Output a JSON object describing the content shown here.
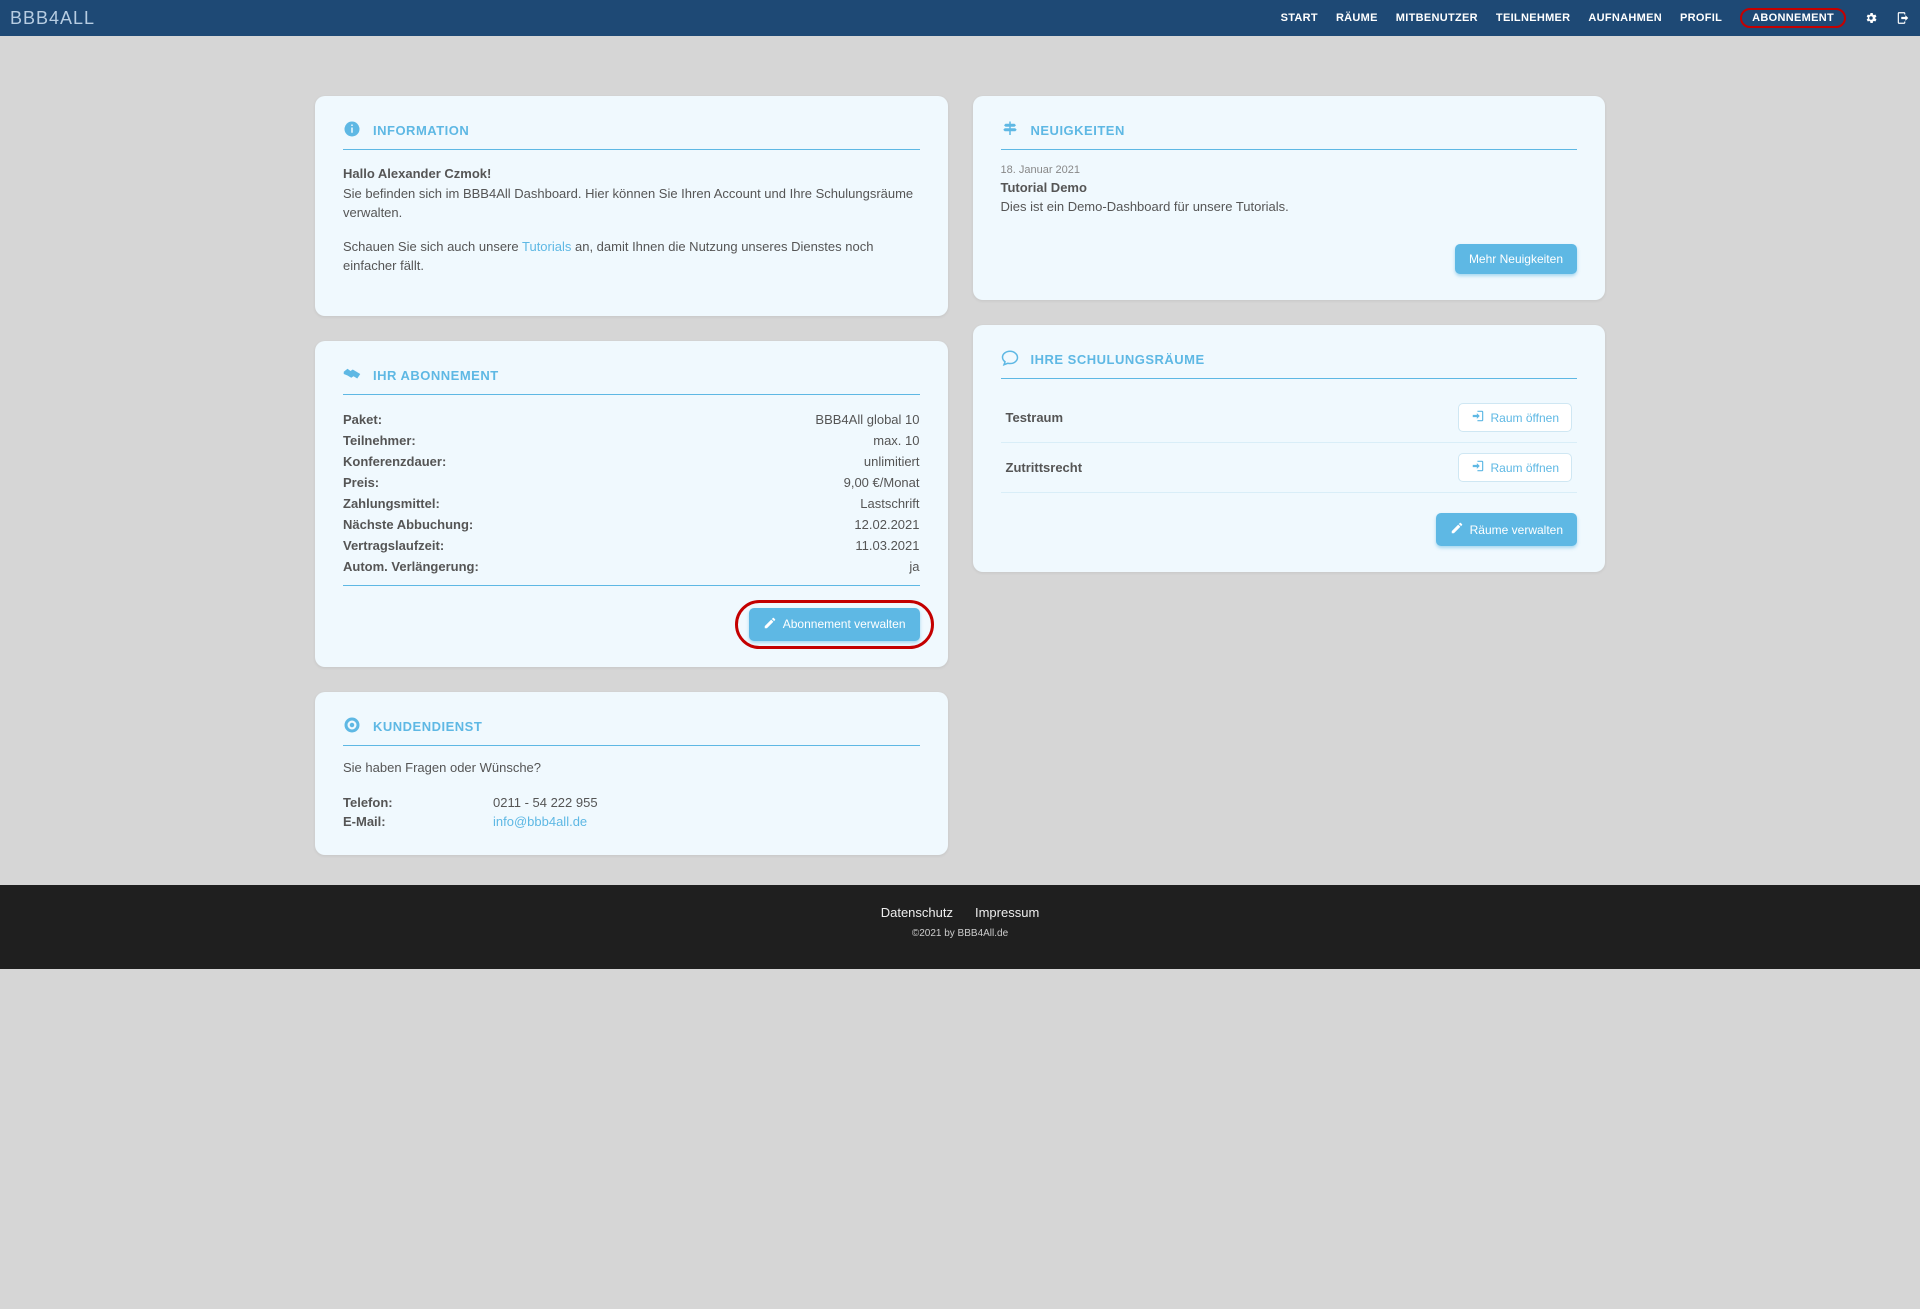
{
  "brand": "BBB4ALL",
  "nav": {
    "start": "START",
    "raeume": "RÄUME",
    "mitbenutzer": "MITBENUTZER",
    "teilnehmer": "TEILNEHMER",
    "aufnahmen": "AUFNAHMEN",
    "profil": "PROFIL",
    "abonnement": "ABONNEMENT"
  },
  "information": {
    "heading": "INFORMATION",
    "greeting": "Hallo Alexander Czmok!",
    "line1": "Sie befinden sich im BBB4All Dashboard. Hier können Sie Ihren Account und Ihre Schulungsräume verwalten.",
    "line2a": "Schauen Sie sich auch unsere ",
    "tutorials_link": "Tutorials",
    "line2b": " an, damit Ihnen die Nutzung unseres Dienstes noch einfacher fällt."
  },
  "abonnement": {
    "heading": "IHR ABONNEMENT",
    "rows": {
      "paket": {
        "label": "Paket:",
        "value": "BBB4All global 10"
      },
      "teilnehmer": {
        "label": "Teilnehmer:",
        "value": "max. 10"
      },
      "konferenzdauer": {
        "label": "Konferenzdauer:",
        "value": "unlimitiert"
      },
      "preis": {
        "label": "Preis:",
        "value": "9,00 €/Monat"
      },
      "zahlungsmittel": {
        "label": "Zahlungsmittel:",
        "value": "Lastschrift"
      },
      "naechste": {
        "label": "Nächste Abbuchung:",
        "value": "12.02.2021"
      },
      "vertragslaufzeit": {
        "label": "Vertragslaufzeit:",
        "value": "11.03.2021"
      },
      "autom": {
        "label": "Autom. Verlängerung:",
        "value": "ja"
      }
    },
    "manage_btn": "Abonnement verwalten"
  },
  "kundendienst": {
    "heading": "KUNDENDIENST",
    "intro": "Sie haben Fragen oder Wünsche?",
    "phone_label": "Telefon:",
    "phone_value": "0211 - 54 222 955",
    "email_label": "E-Mail:",
    "email_value": "info@bbb4all.de"
  },
  "neuigkeiten": {
    "heading": "NEUIGKEITEN",
    "date": "18. Januar 2021",
    "title": "Tutorial Demo",
    "text": "Dies ist ein Demo-Dashboard für unsere Tutorials.",
    "more_btn": "Mehr Neuigkeiten"
  },
  "schulungsraeume": {
    "heading": "IHRE SCHULUNGSRÄUME",
    "rooms": [
      {
        "name": "Testraum",
        "open": "Raum öffnen"
      },
      {
        "name": "Zutrittsrecht",
        "open": "Raum öffnen"
      }
    ],
    "manage_btn": "Räume verwalten"
  },
  "footer": {
    "datenschutz": "Datenschutz",
    "impressum": "Impressum",
    "copyright": "©2021 by BBB4All.de"
  }
}
